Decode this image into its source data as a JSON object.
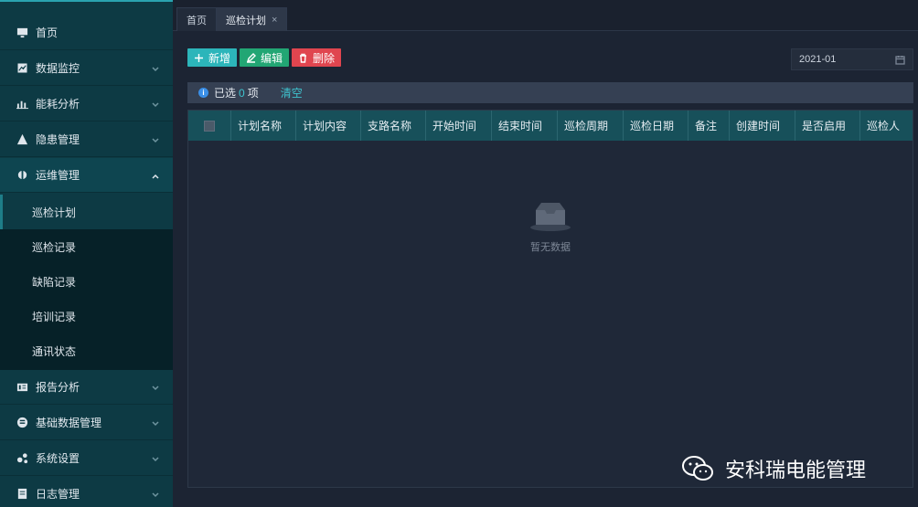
{
  "sidebar": {
    "items": [
      {
        "label": "首页",
        "icon": "monitor-icon"
      },
      {
        "label": "数据监控",
        "icon": "chart-box-icon"
      },
      {
        "label": "能耗分析",
        "icon": "bar-chart-icon"
      },
      {
        "label": "隐患管理",
        "icon": "warning-icon"
      },
      {
        "label": "运维管理",
        "icon": "tool-icon"
      },
      {
        "label": "报告分析",
        "icon": "report-icon"
      },
      {
        "label": "基础数据管理",
        "icon": "database-icon"
      },
      {
        "label": "系统设置",
        "icon": "settings-icon"
      },
      {
        "label": "日志管理",
        "icon": "log-icon"
      }
    ],
    "submenu": [
      {
        "label": "巡检计划"
      },
      {
        "label": "巡检记录"
      },
      {
        "label": "缺陷记录"
      },
      {
        "label": "培训记录"
      },
      {
        "label": "通讯状态"
      }
    ]
  },
  "tabs": [
    {
      "label": "首页"
    },
    {
      "label": "巡检计划",
      "close": "×"
    }
  ],
  "toolbar": {
    "add_label": "新增",
    "edit_label": "编辑",
    "delete_label": "删除",
    "date_value": "2021-01"
  },
  "selection": {
    "prefix": "已选",
    "count": "0",
    "suffix": "项",
    "clear_label": "清空"
  },
  "table": {
    "columns": [
      "计划名称",
      "计划内容",
      "支路名称",
      "开始时间",
      "结束时间",
      "巡检周期",
      "巡检日期",
      "备注",
      "创建时间",
      "是否启用",
      "巡检人"
    ],
    "empty_text": "暂无数据"
  },
  "watermark": {
    "text": "安科瑞电能管理"
  },
  "colors": {
    "sidebar_bg": "#0d3a44",
    "header_bg": "#17505a",
    "accent": "#2cb5ba",
    "edit": "#22a674",
    "danger": "#e0454f"
  }
}
